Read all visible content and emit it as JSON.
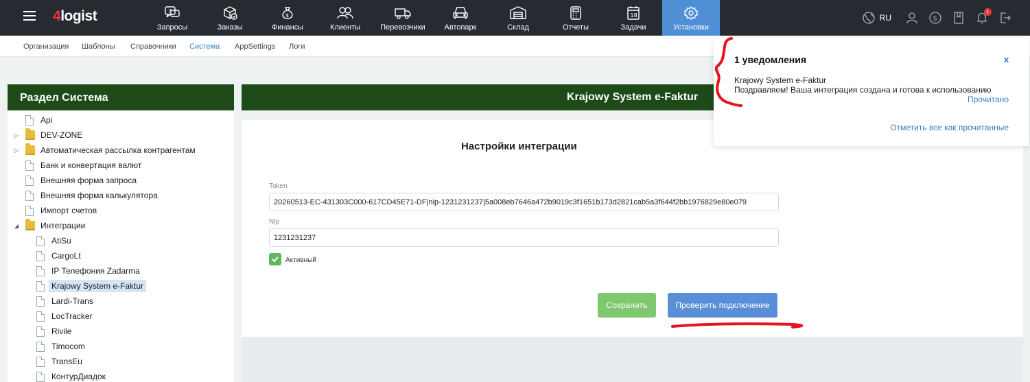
{
  "header": {
    "logo_num": "4",
    "logo_text": "logist",
    "nav": [
      {
        "label": "Запросы",
        "icon": "question-chat-icon"
      },
      {
        "label": "Заказы",
        "icon": "orders-box-icon"
      },
      {
        "label": "Финансы",
        "icon": "money-bag-icon"
      },
      {
        "label": "Клиенты",
        "icon": "clients-icon"
      },
      {
        "label": "Перевозчики",
        "icon": "truck-icon"
      },
      {
        "label": "Автопарк",
        "icon": "car-icon"
      },
      {
        "label": "Склад",
        "icon": "warehouse-icon"
      },
      {
        "label": "Отчеты",
        "icon": "calculator-icon"
      },
      {
        "label": "Задачи",
        "icon": "calendar-icon"
      },
      {
        "label": "Установки",
        "icon": "gear-icon",
        "active": true
      }
    ],
    "lang": "RU",
    "notif_count": "1"
  },
  "subnav": [
    "Организация",
    "Шаблоны",
    "Справочники",
    "Система",
    "AppSettings",
    "Логи"
  ],
  "sidebar": {
    "title": "Раздел Система",
    "items": [
      {
        "label": "Api",
        "type": "doc"
      },
      {
        "label": "DEV-ZONE",
        "type": "folder",
        "toggle": "closed"
      },
      {
        "label": "Автоматическая рассылка контрагентам",
        "type": "folder",
        "toggle": "closed"
      },
      {
        "label": "Банк и конвертация валют",
        "type": "doc"
      },
      {
        "label": "Внешняя форма запроса",
        "type": "doc"
      },
      {
        "label": "Внешняя форма калькулятора",
        "type": "doc"
      },
      {
        "label": "Импорт счетов",
        "type": "doc"
      },
      {
        "label": "Интеграции",
        "type": "folder",
        "toggle": "open"
      },
      {
        "label": "AtiSu",
        "type": "doc",
        "child": true
      },
      {
        "label": "CargoLt",
        "type": "doc",
        "child": true
      },
      {
        "label": "IP Телефония Zadarma",
        "type": "doc",
        "child": true
      },
      {
        "label": "Krajowy System e-Faktur",
        "type": "doc",
        "child": true,
        "selected": true
      },
      {
        "label": "Lardi-Trans",
        "type": "doc",
        "child": true
      },
      {
        "label": "LocTracker",
        "type": "doc",
        "child": true
      },
      {
        "label": "Rivile",
        "type": "doc",
        "child": true
      },
      {
        "label": "Timocom",
        "type": "doc",
        "child": true
      },
      {
        "label": "TransEu",
        "type": "doc",
        "child": true
      },
      {
        "label": "КонтурДиадок",
        "type": "doc",
        "child": true
      }
    ]
  },
  "main": {
    "title": "Krajowy System e-Faktur",
    "settings_title": "Настройки интеграции",
    "token_label": "Token",
    "token_value": "20260513-EC-431303C000-617CD45E71-DF|nip-1231231237|5a008eb7646a472b9019c3f1651b173d2821cab5a3f644f2bb1976829e80e079",
    "nip_label": "Nip",
    "nip_value": "1231231237",
    "active_label": "Активный",
    "active": true,
    "save_label": "Сохранить",
    "check_label": "Проверить подключение"
  },
  "notifications": {
    "title": "1 уведомления",
    "close": "x",
    "message_title": "Krajowy System e-Faktur",
    "message_text": "Поздравляем! Ваша интеграция создана и готова к использованию",
    "read_label": "Прочитано",
    "read_all_label": "Отметить все как прочитанные"
  },
  "colors": {
    "topbar": "#262b31",
    "active_nav": "#4f8fd6",
    "panel_header": "#1d4a17",
    "save_button": "#80c870",
    "check_button": "#5a8fd8",
    "annotation": "#e8141b"
  }
}
